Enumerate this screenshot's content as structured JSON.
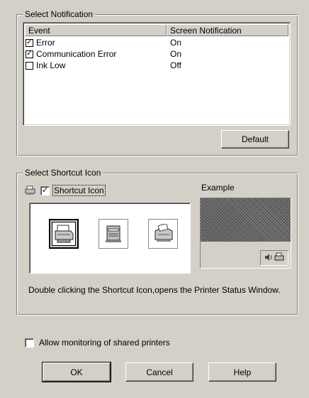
{
  "notification_group": {
    "title": "Select Notification",
    "columns": [
      "Event",
      "Screen Notification"
    ],
    "rows": [
      {
        "event": "Error",
        "checked": true,
        "mark": "✓",
        "notification": "On"
      },
      {
        "event": "Communication Error",
        "checked": true,
        "mark": "✓",
        "notification": "On"
      },
      {
        "event": "Ink Low",
        "checked": false,
        "mark": "",
        "notification": "Off"
      }
    ],
    "default_label": "Default"
  },
  "shortcut_group": {
    "title": "Select Shortcut Icon",
    "checkbox_label": "Shortcut Icon",
    "checkbox_checked": true,
    "checkbox_mark": "✓",
    "icons": [
      "printer-icon",
      "printer-icon",
      "printer-icon"
    ],
    "selected_icon": 0,
    "example_label": "Example",
    "description": "Double clicking the Shortcut Icon,opens the Printer Status Window."
  },
  "monitoring": {
    "label": "Allow monitoring of shared printers",
    "checked": false
  },
  "buttons": {
    "ok": "OK",
    "cancel": "Cancel",
    "help": "Help"
  },
  "colors": {
    "face": "#d4d0c8",
    "shadow": "#808080",
    "highlight": "#ffffff"
  }
}
